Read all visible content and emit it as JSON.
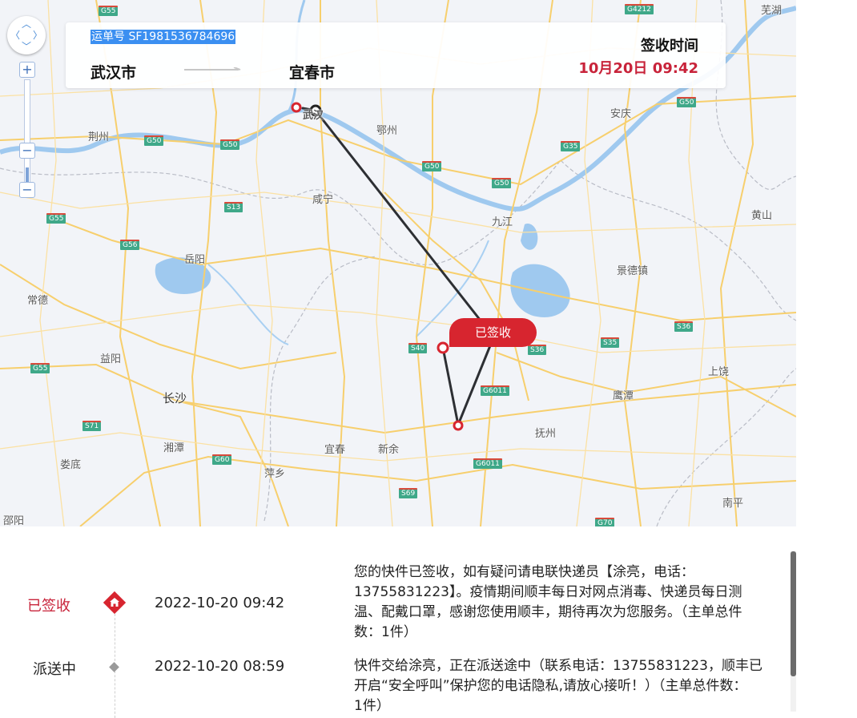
{
  "shipment": {
    "waybill_label": "运单号 SF1981536784696",
    "from_city": "武汉市",
    "to_city": "宜春市",
    "sign_time_label": "签收时间",
    "sign_time_value": "10月20日 09:42",
    "badge": "已签收"
  },
  "map": {
    "controls": {
      "zoom_in": "+",
      "zoom_out": "−"
    },
    "zoom_level_fraction": 0.15,
    "cities": {
      "wuhan": "武汉",
      "ezhou": "鄂州",
      "jingzhou": "荆州",
      "xianning": "咸宁",
      "yueyang": "岳阳",
      "jiujiang": "九江",
      "anqing": "安庆",
      "jingdezhen": "景德镇",
      "huangshan": "黄山",
      "changde": "常德",
      "yiyang": "益阳",
      "changsha": "长沙",
      "xiangtan": "湘潭",
      "loudi": "娄底",
      "pingxiang": "萍乡",
      "yichun": "宜春",
      "xinyu": "新余",
      "fuzhou": "抚州",
      "yingtan": "鹰潭",
      "shangrao": "上饶",
      "nanping": "南平",
      "shaoyang": "邵阳",
      "wuhu": "芜湖"
    },
    "highways": [
      "G55",
      "G4212",
      "G50",
      "G50",
      "G50",
      "G35",
      "G50",
      "G50",
      "S13",
      "G55",
      "G56",
      "S40",
      "S36",
      "S35",
      "S36",
      "G6011",
      "G6011",
      "S71",
      "G60",
      "S69",
      "G70",
      "G55"
    ]
  },
  "timeline": {
    "rows": [
      {
        "status": "已签收",
        "time": "2022-10-20 09:42",
        "desc_lines": [
          "您的快件已签收，如有疑问请电联快递员【涂亮，电话：",
          "13755831223】。疫情期间顺丰每日对网点消毒、快递员每日测",
          "温、配戴口罩，感谢您使用顺丰，期待再次为您服务。（主单总件",
          "数：1件）"
        ]
      },
      {
        "status": "派送中",
        "time": "2022-10-20 08:59",
        "desc_lines": [
          "快件交给涂亮，正在派送途中（联系电话：13755831223，顺丰已",
          "开启“安全呼叫”保护您的电话隐私,请放心接听！）（主单总件数：",
          "1件）"
        ]
      }
    ]
  },
  "colors": {
    "accent_red": "#c8233a",
    "badge_red": "#d7252f",
    "highlight_blue": "#3b8ff1"
  }
}
